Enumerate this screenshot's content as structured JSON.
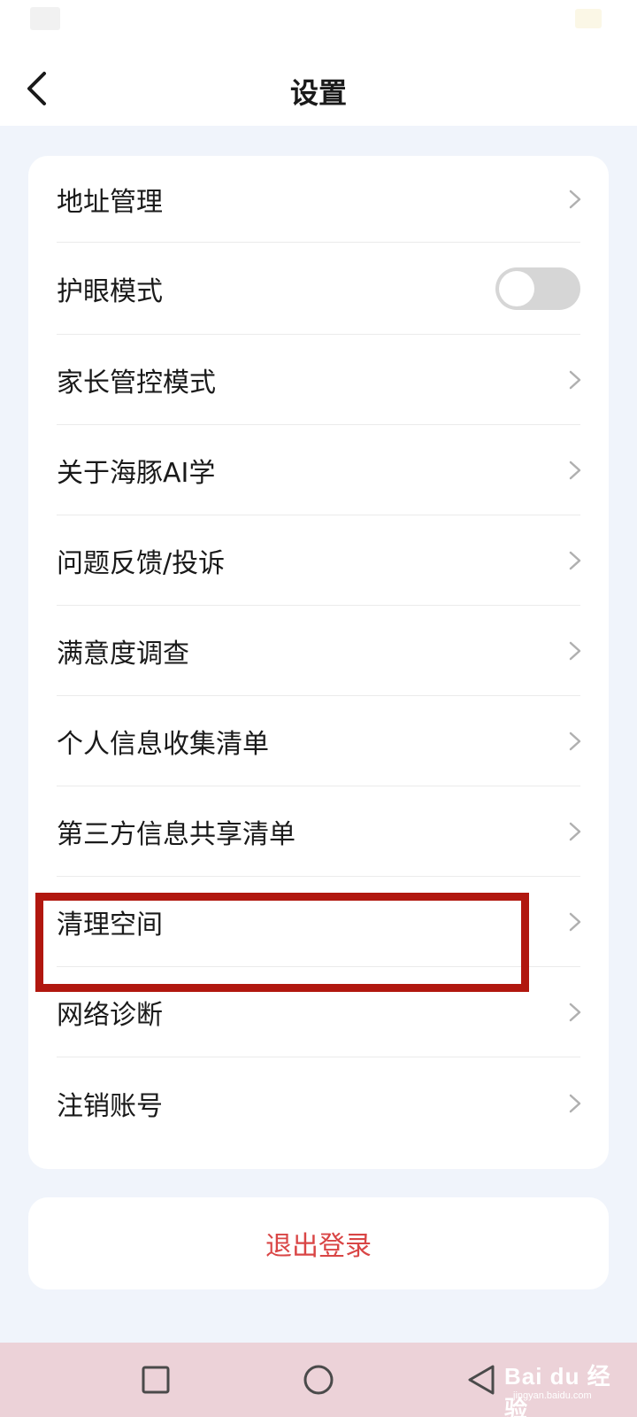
{
  "header": {
    "title": "设置",
    "back_icon": "chevron-left-icon"
  },
  "settings": {
    "items": [
      {
        "label": "地址管理",
        "type": "link"
      },
      {
        "label": "护眼模式",
        "type": "toggle",
        "toggle_on": false
      },
      {
        "label": "家长管控模式",
        "type": "link"
      },
      {
        "label": "关于海豚AI学",
        "type": "link"
      },
      {
        "label": "问题反馈/投诉",
        "type": "link"
      },
      {
        "label": "满意度调查",
        "type": "link"
      },
      {
        "label": "个人信息收集清单",
        "type": "link"
      },
      {
        "label": "第三方信息共享清单",
        "type": "link"
      },
      {
        "label": "清理空间",
        "type": "link",
        "highlighted": true
      },
      {
        "label": "网络诊断",
        "type": "link"
      },
      {
        "label": "注销账号",
        "type": "link"
      }
    ]
  },
  "logout": {
    "label": "退出登录",
    "color": "#d94545"
  },
  "nav_bar": {
    "buttons": [
      "recent-apps-square-icon",
      "home-circle-icon",
      "back-triangle-icon"
    ]
  },
  "watermark": {
    "main": "Bai du 经验",
    "sub": "jingyan.baidu.com"
  },
  "colors": {
    "page_background": "#f0f4fb",
    "card_background": "#ffffff",
    "highlight_border": "#b1170f",
    "nav_bar_background": "#ecd2d8",
    "toggle_off": "#d6d6d6"
  }
}
